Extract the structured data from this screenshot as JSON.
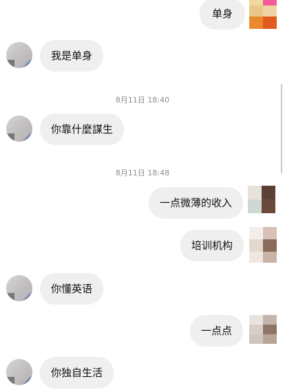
{
  "messages": [
    {
      "side": "right",
      "text": "单身"
    },
    {
      "side": "left",
      "text": "我是单身"
    },
    {
      "type": "timestamp",
      "text": "8月11日 18:40"
    },
    {
      "side": "left",
      "text": "你靠什麼謀生"
    },
    {
      "type": "timestamp",
      "text": "8月11日 18:48"
    },
    {
      "side": "right",
      "text": "一点微薄的收入"
    },
    {
      "side": "right",
      "text": "培训机构"
    },
    {
      "side": "left",
      "text": "你懂英语"
    },
    {
      "side": "right",
      "text": "一点点"
    },
    {
      "side": "left",
      "text": "你独自生活"
    }
  ],
  "colors": {
    "bubble": "#efefef",
    "timestamp": "#8d8d8d",
    "background": "#ffffff"
  }
}
